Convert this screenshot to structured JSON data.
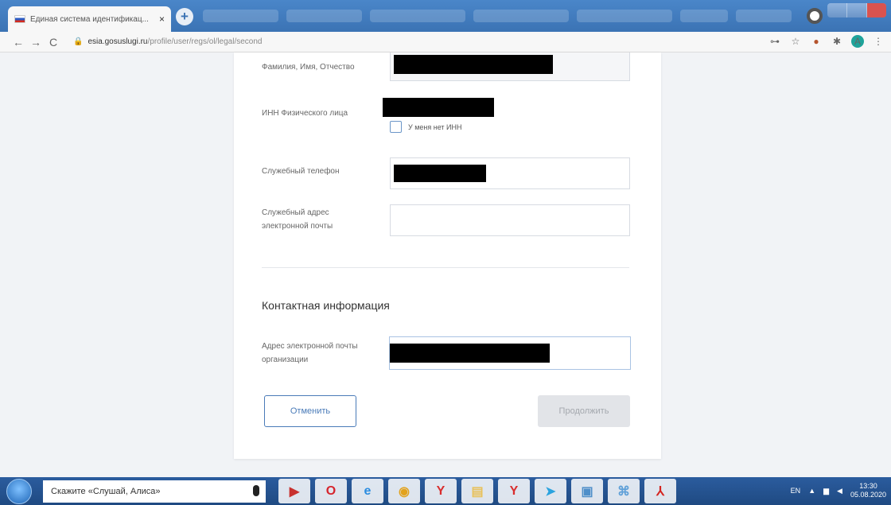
{
  "browser": {
    "tab_title": "Единая система идентификац...",
    "tab_close": "×",
    "new_tab": "+",
    "url_domain": "esia.gosuslugi.ru",
    "url_path": "/profile/user/regs/ol/legal/second",
    "back": "←",
    "forward": "→",
    "reload": "C",
    "lock": "🔒",
    "toolbar_icons": [
      "key-icon",
      "star-icon",
      "extension-icon",
      "puzzle-icon"
    ],
    "toolbar_glyphs": [
      "⊶",
      "☆",
      "●",
      "✱"
    ],
    "profile_initial": "А",
    "menu": "⋮"
  },
  "form": {
    "fio_label": "Фамилия, Имя, Отчество",
    "inn_label": "ИНН Физического лица",
    "no_inn_label": "У меня нет ИНН",
    "phone_label": "Служебный телефон",
    "email_label": "Служебный адрес электронной почты",
    "contact_title": "Контактная информация",
    "org_email_label": "Адрес электронной почты организации",
    "cancel_label": "Отменить",
    "continue_label": "Продолжить"
  },
  "taskbar": {
    "search_text": "Скажите «Слушай, Алиса»",
    "apps": [
      {
        "name": "media-app-icon",
        "glyph": "▶",
        "color": "#c8312f"
      },
      {
        "name": "opera-icon",
        "glyph": "O",
        "color": "#d6252d"
      },
      {
        "name": "ie-icon",
        "glyph": "e",
        "color": "#2c8de0"
      },
      {
        "name": "chrome-icon",
        "glyph": "◉",
        "color": "#e2a21c"
      },
      {
        "name": "yandex-browser-icon",
        "glyph": "Y",
        "color": "#d92d2d"
      },
      {
        "name": "file-explorer-icon",
        "glyph": "▤",
        "color": "#e8c15a"
      },
      {
        "name": "yandex-app-icon",
        "glyph": "Y",
        "color": "#d92d2d"
      },
      {
        "name": "telegram-icon",
        "glyph": "➤",
        "color": "#2aa3df"
      },
      {
        "name": "photos-icon",
        "glyph": "▣",
        "color": "#4f8fc9"
      },
      {
        "name": "network-app-icon",
        "glyph": "⌘",
        "color": "#5fa0d8"
      },
      {
        "name": "acrobat-icon",
        "glyph": "⅄",
        "color": "#d4231f"
      }
    ],
    "lang": "EN",
    "time": "13:30",
    "date": "05.08.2020"
  },
  "colors": {
    "accent": "#4a7bb8",
    "taskbar": "#1f4a82"
  }
}
